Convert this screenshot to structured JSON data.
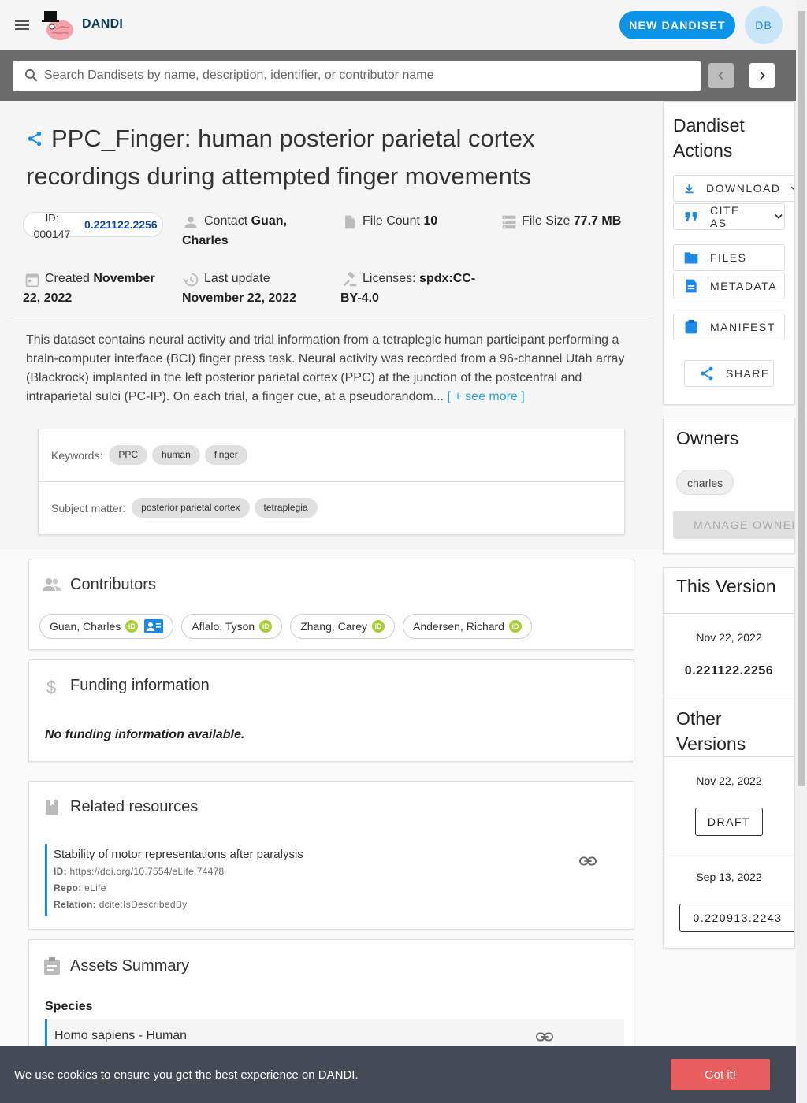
{
  "header": {
    "brand": "DANDI",
    "new_button": "NEW DANDISET",
    "avatar_initials": "DB",
    "search_placeholder": "Search Dandisets by name, description, identifier, or contributor name"
  },
  "dandiset": {
    "title": "PPC_Finger: human posterior parietal cortex recordings during attempted finger movements",
    "id_label": "ID:",
    "id_value": "000147",
    "version": "0.221122.2256",
    "contact_label": "Contact",
    "contact_name": "Guan, Charles",
    "file_count_label": "File Count",
    "file_count": "10",
    "file_size_label": "File Size",
    "file_size": "77.7 MB",
    "created_label": "Created",
    "created_value": "November 22, 2022",
    "updated_label": "Last update",
    "updated_value": "November 22, 2022",
    "license_label": "Licenses:",
    "license_value": "spdx:CC-BY-4.0",
    "description": "This dataset contains neural activity and trial information from a tetraplegic human participant performing a brain-computer interface (BCI) finger press task. Neural activity was recorded from a 96-channel Utah array (Blackrock) implanted in the left posterior parietal cortex (PPC) at the junction of the postcentral and intraparietal sulci (PC-IP). On each trial, a finger cue, at a pseudorandom...",
    "see_more": "[ + see more ]",
    "keywords_label": "Keywords:",
    "keywords": [
      "PPC",
      "human",
      "finger"
    ],
    "subject_label": "Subject matter:",
    "subjects": [
      "posterior parietal cortex",
      "tetraplegia"
    ]
  },
  "contributors": {
    "title": "Contributors",
    "people": [
      "Guan, Charles",
      "Aflalo, Tyson",
      "Zhang, Carey",
      "Andersen, Richard"
    ],
    "orcid_glyph": "iD"
  },
  "funding": {
    "title": "Funding information",
    "empty": "No funding information available."
  },
  "related": {
    "title": "Related resources",
    "item_title": "Stability of motor representations after paralysis",
    "id_label": "ID:",
    "id_value": "https://doi.org/10.7554/eLife.74478",
    "repo_label": "Repo:",
    "repo_value": "eLife",
    "relation_label": "Relation:",
    "relation_value": "dcite:IsDescribedBy"
  },
  "assets": {
    "title": "Assets Summary",
    "species_label": "Species",
    "species_item": "Homo sapiens - Human"
  },
  "actions": {
    "title": "Dandiset Actions",
    "download": "DOWNLOAD",
    "cite": "CITE AS",
    "files": "FILES",
    "metadata": "METADATA",
    "manifest": "MANIFEST",
    "share": "SHARE"
  },
  "owners": {
    "title": "Owners",
    "owner": "charles",
    "manage": "MANAGE OWNERS"
  },
  "versions": {
    "this_title": "This Version",
    "this_date": "Nov 22, 2022",
    "this_version": "0.221122.2256",
    "other_title": "Other Versions",
    "draft_date": "Nov 22, 2022",
    "draft_label": "DRAFT",
    "old_date": "Sep 13, 2022",
    "old_label": "0.220913.2243"
  },
  "cookie": {
    "text": "We use cookies to ensure you get the best experience on DANDI.",
    "button": "Got it!"
  },
  "colors": {
    "accent": "#0b93e8",
    "link": "#29a4dd",
    "cookie_bg": "#444a56",
    "cookie_btn": "#e85d5d"
  }
}
